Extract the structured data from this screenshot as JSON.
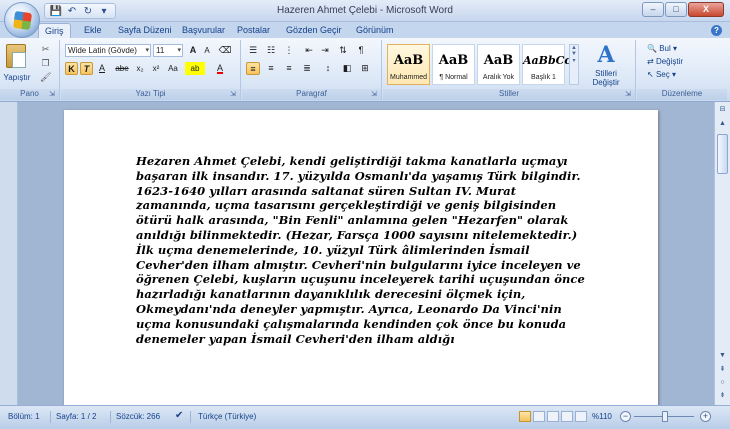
{
  "window": {
    "title": "Hazeren Ahmet Çelebi - Microsoft Word",
    "buttons": {
      "minimize": "–",
      "maximize": "□",
      "close": "X"
    }
  },
  "quick_access": {
    "save": "💾",
    "undo": "↶",
    "redo": "↻",
    "more": "▾"
  },
  "tabs": [
    "Giriş",
    "Ekle",
    "Sayfa Düzeni",
    "Başvurular",
    "Postalar",
    "Gözden Geçir",
    "Görünüm"
  ],
  "ribbon": {
    "clipboard": {
      "label": "Pano",
      "paste": "Yapıştır"
    },
    "font": {
      "label": "Yazı Tipi",
      "family": "Wide Latin (Gövde)",
      "size": "11",
      "grow": "A",
      "shrink": "A",
      "bold": "K",
      "italic": "T",
      "underline": "A",
      "strike": "abe",
      "subscript": "x₂",
      "superscript": "x²",
      "case": "Aa",
      "highlight": "ab",
      "color": "A"
    },
    "paragraph": {
      "label": "Paragraf"
    },
    "styles": {
      "label": "Stiller",
      "items": [
        {
          "sample": "AaB",
          "name": "Muhammed"
        },
        {
          "sample": "AaB",
          "name": "¶ Normal"
        },
        {
          "sample": "AaB",
          "name": "Aralık Yok"
        },
        {
          "sample": "AaBbCcI",
          "name": "Başlık 1"
        }
      ],
      "change": "Stilleri Değiştir"
    },
    "editing": {
      "label": "Düzenleme",
      "find": "Bul",
      "replace": "Değiştir",
      "select": "Seç"
    }
  },
  "document": {
    "text": "Hezaren Ahmet Çelebi, kendi geliştirdiği takma kanatlarla uçmayı başaran ilk insandır. 17. yüzyılda Osmanlı'da yaşamış Türk bilgindir. 1623-1640 yılları arasında saltanat süren Sultan IV. Murat zamanında, uçma tasarısını gerçekleştirdiği ve geniş bilgisinden ötürü halk arasında, \"Bin Fenli\" anlamına gelen \"Hezarfen\" olarak anıldığı bilinmektedir. (Hezar, Farsça 1000 sayısını nitelemektedir.)\nİlk uçma denemelerinde, 10. yüzyıl Türk âlimlerinden İsmail Cevher'den ilham almıştır. Cevheri'nin bulgularını iyice inceleyen ve öğrenen Çelebi, kuşların uçuşunu inceleyerek tarihi uçuşundan önce hazırladığı kanatlarının dayanıklılık derecesini ölçmek için, Okmeydanı'nda deneyler yapmıştır. Ayrıca, Leonardo Da Vinci'nin uçma konusundaki çalışmalarında kendinden çok önce bu konuda denemeler yapan İsmail Cevheri'den ilham aldığı"
  },
  "status": {
    "section": "Bölüm: 1",
    "page": "Sayfa: 1 / 2",
    "words": "Sözcük: 266",
    "language": "Türkçe (Türkiye)",
    "zoom": "%110",
    "zoom_percent": 110
  }
}
